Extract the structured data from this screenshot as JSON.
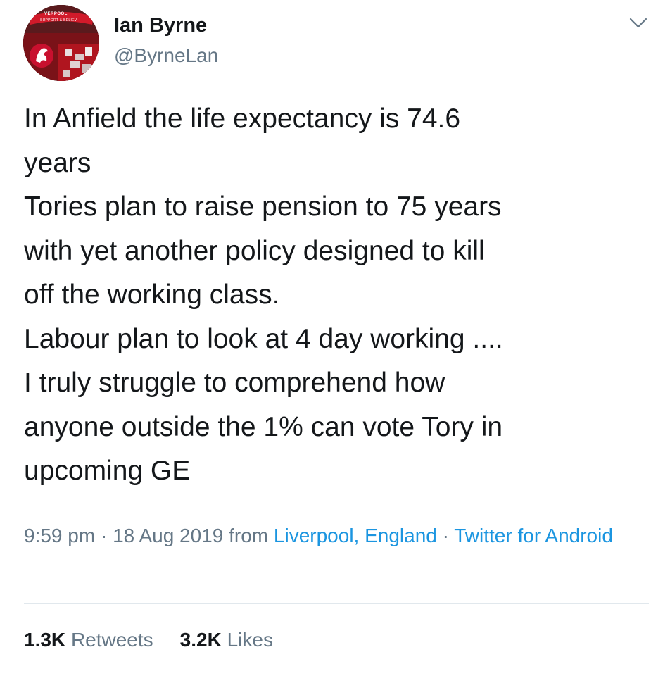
{
  "author": {
    "name": "Ian Byrne",
    "handle": "@ByrneLan"
  },
  "avatar": {
    "banner_text_1": "VERPOOL",
    "banner_text_2": "SUPPORT & BELIEV"
  },
  "tweet": {
    "lines": [
      "In Anfield the life expectancy is 74.6",
      "years",
      "Tories plan to raise pension to 75 years",
      "with yet another policy designed to kill",
      "off the working class.",
      "Labour plan to look at 4 day working ....",
      "I truly struggle to comprehend how",
      "anyone outside the 1% can vote Tory in",
      "upcoming GE"
    ]
  },
  "meta": {
    "time": "9:59 pm",
    "separator_1": " · ",
    "date": "18 Aug 2019",
    "from_text": " from ",
    "location": "Liverpool, England",
    "separator_2": " · ",
    "source": "Twitter for Android"
  },
  "stats": {
    "retweets_count": "1.3K",
    "retweets_label": "Retweets",
    "likes_count": "3.2K",
    "likes_label": "Likes"
  },
  "icons": {
    "menu": "chevron-down-icon"
  },
  "colors": {
    "text_primary": "#14171a",
    "text_secondary": "#657786",
    "link": "#1b95e0",
    "divider": "#e1e8ed",
    "avatar_red": "#c8102e"
  }
}
